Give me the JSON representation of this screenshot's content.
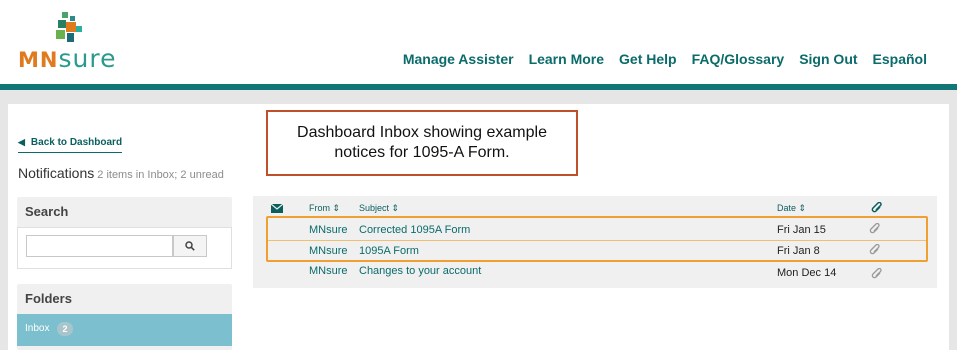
{
  "brand": {
    "logo_text": "MNsure",
    "logo_alt": "MNsure logo"
  },
  "nav": [
    "Manage Assister",
    "Learn More",
    "Get Help",
    "FAQ/Glossary",
    "Sign Out",
    "Español"
  ],
  "sidebar": {
    "back_label": "Back to Dashboard",
    "notifications_title": "Notifications",
    "notifications_summary": "2 items in Inbox; 2 unread",
    "search_title": "Search",
    "search_value": "",
    "search_placeholder": "",
    "folders_title": "Folders",
    "folders": [
      {
        "label": "Inbox",
        "count": "2"
      }
    ]
  },
  "annotation": "Dashboard Inbox showing example notices for 1095-A Form.",
  "table": {
    "columns": {
      "from": "From",
      "subject": "Subject",
      "date": "Date"
    },
    "rows": [
      {
        "from": "MNsure",
        "subject": "Corrected 1095A Form",
        "date": "Fri Jan 15"
      },
      {
        "from": "MNsure",
        "subject": "1095A Form",
        "date": "Fri Jan 8"
      },
      {
        "from": "MNsure",
        "subject": "Changes to your account",
        "date": "Mon Dec 14"
      }
    ]
  },
  "icons": {
    "sort": "sort-icon",
    "paperclip": "paperclip-icon",
    "envelope": "envelope-icon",
    "search": "search-icon",
    "back": "caret-left-icon"
  },
  "colors": {
    "brand_teal": "#127676",
    "link": "#0b6b6b",
    "annotation_border": "#c0502a",
    "highlight_border": "#f0a030",
    "inbox_selected": "#7cc0cf"
  }
}
